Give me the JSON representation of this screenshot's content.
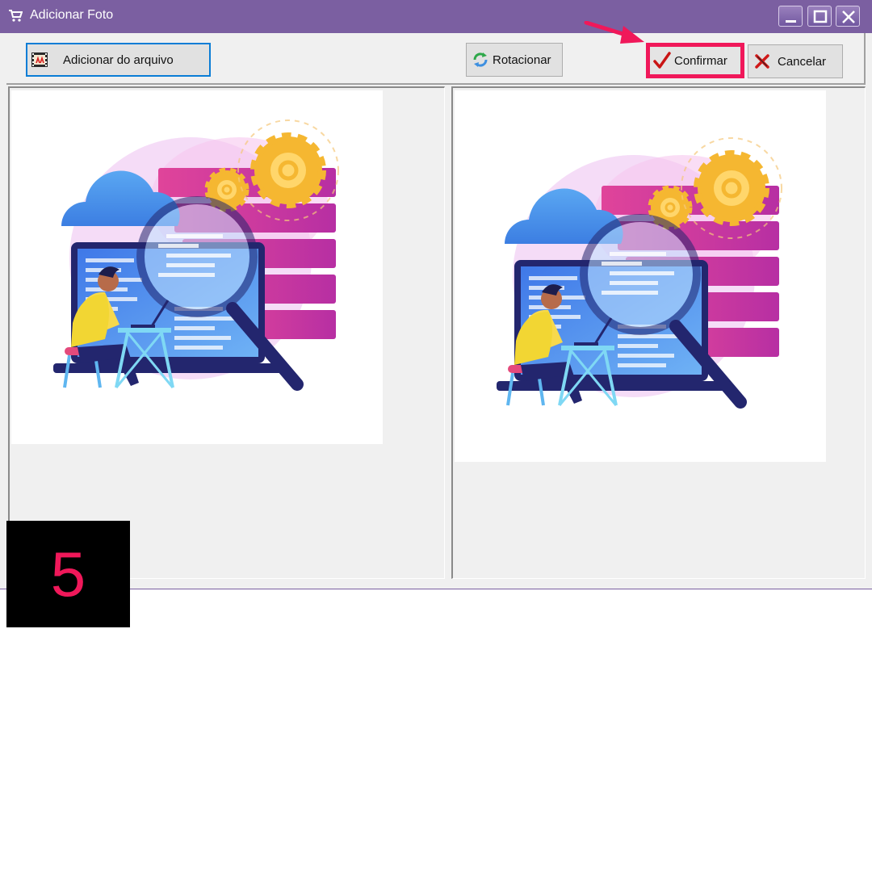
{
  "window": {
    "title": "Adicionar Foto",
    "title_icon": "cart-icon",
    "controls": [
      "minimize-icon",
      "maximize-icon",
      "close-icon"
    ],
    "titlebar_color": "#7b5fa1"
  },
  "toolbar": {
    "add_label": "Adicionar do arquivo",
    "add_icon": "film-strip-icon",
    "rotate_label": "Rotacionar",
    "rotate_icon": "rotate-icon",
    "confirm_label": "Confirmar",
    "confirm_icon": "checkmark-icon",
    "cancel_label": "Cancelar",
    "cancel_icon": "x-icon"
  },
  "highlight": {
    "target": "confirm-button",
    "color": "#f0185a",
    "pointer": "arrow-icon"
  },
  "panels": {
    "left": {
      "content": "illustration-magnifier-laptop"
    },
    "right": {
      "content": "illustration-magnifier-laptop"
    }
  },
  "step": {
    "number": "5",
    "color": "#f0185a"
  }
}
